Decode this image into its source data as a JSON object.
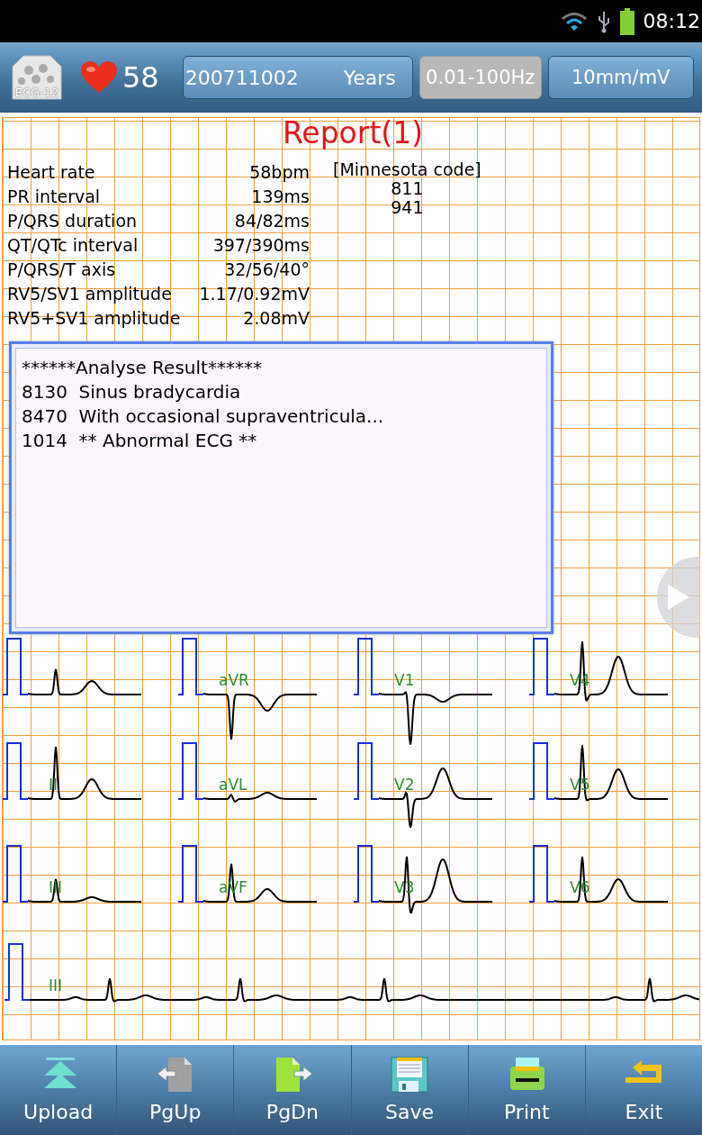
{
  "status_bar": {
    "time": "08:12"
  },
  "header": {
    "logo_label": "ECG-12",
    "heart_rate": "58",
    "patient_id": "200711002",
    "age_unit": "Years",
    "buttons": [
      {
        "label": "0.01-100Hz",
        "disabled": true
      },
      {
        "label": "10mm/mV",
        "disabled": false
      }
    ]
  },
  "report": {
    "title": "Report(1)",
    "measurements": [
      {
        "label": "Heart rate",
        "value": "58bpm"
      },
      {
        "label": "PR interval",
        "value": "139ms"
      },
      {
        "label": "P/QRS duration",
        "value": "84/82ms"
      },
      {
        "label": "QT/QTc interval",
        "value": "397/390ms"
      },
      {
        "label": "P/QRS/T axis",
        "value": "32/56/40°"
      },
      {
        "label": "RV5/SV1 amplitude",
        "value": "1.17/0.92mV"
      },
      {
        "label": "RV5+SV1 amplitude",
        "value": "2.08mV"
      }
    ],
    "code_heading": "[Minnesota code]",
    "codes": [
      "811",
      "941"
    ],
    "analysis": {
      "heading": "******Analyse Result******",
      "lines": [
        {
          "code": "8130",
          "text": "Sinus bradycardia"
        },
        {
          "code": "8470",
          "text": "With occasional supraventricula..."
        },
        {
          "code": "1014",
          "text": "** Abnormal ECG **"
        }
      ]
    },
    "lead_labels": [
      "aVR",
      "V1",
      "V4",
      "II",
      "aVL",
      "V2",
      "V5",
      "III",
      "aVF",
      "V3",
      "V6"
    ],
    "rhythm_label": "III"
  },
  "toolbar": [
    {
      "label": "Upload",
      "kind": "upload",
      "disabled": false
    },
    {
      "label": "PgUp",
      "kind": "pgup",
      "disabled": true
    },
    {
      "label": "PgDn",
      "kind": "pgdn",
      "disabled": false
    },
    {
      "label": "Save",
      "kind": "save",
      "disabled": false
    },
    {
      "label": "Print",
      "kind": "print",
      "disabled": false
    },
    {
      "label": "Exit",
      "kind": "exit",
      "disabled": false
    }
  ]
}
